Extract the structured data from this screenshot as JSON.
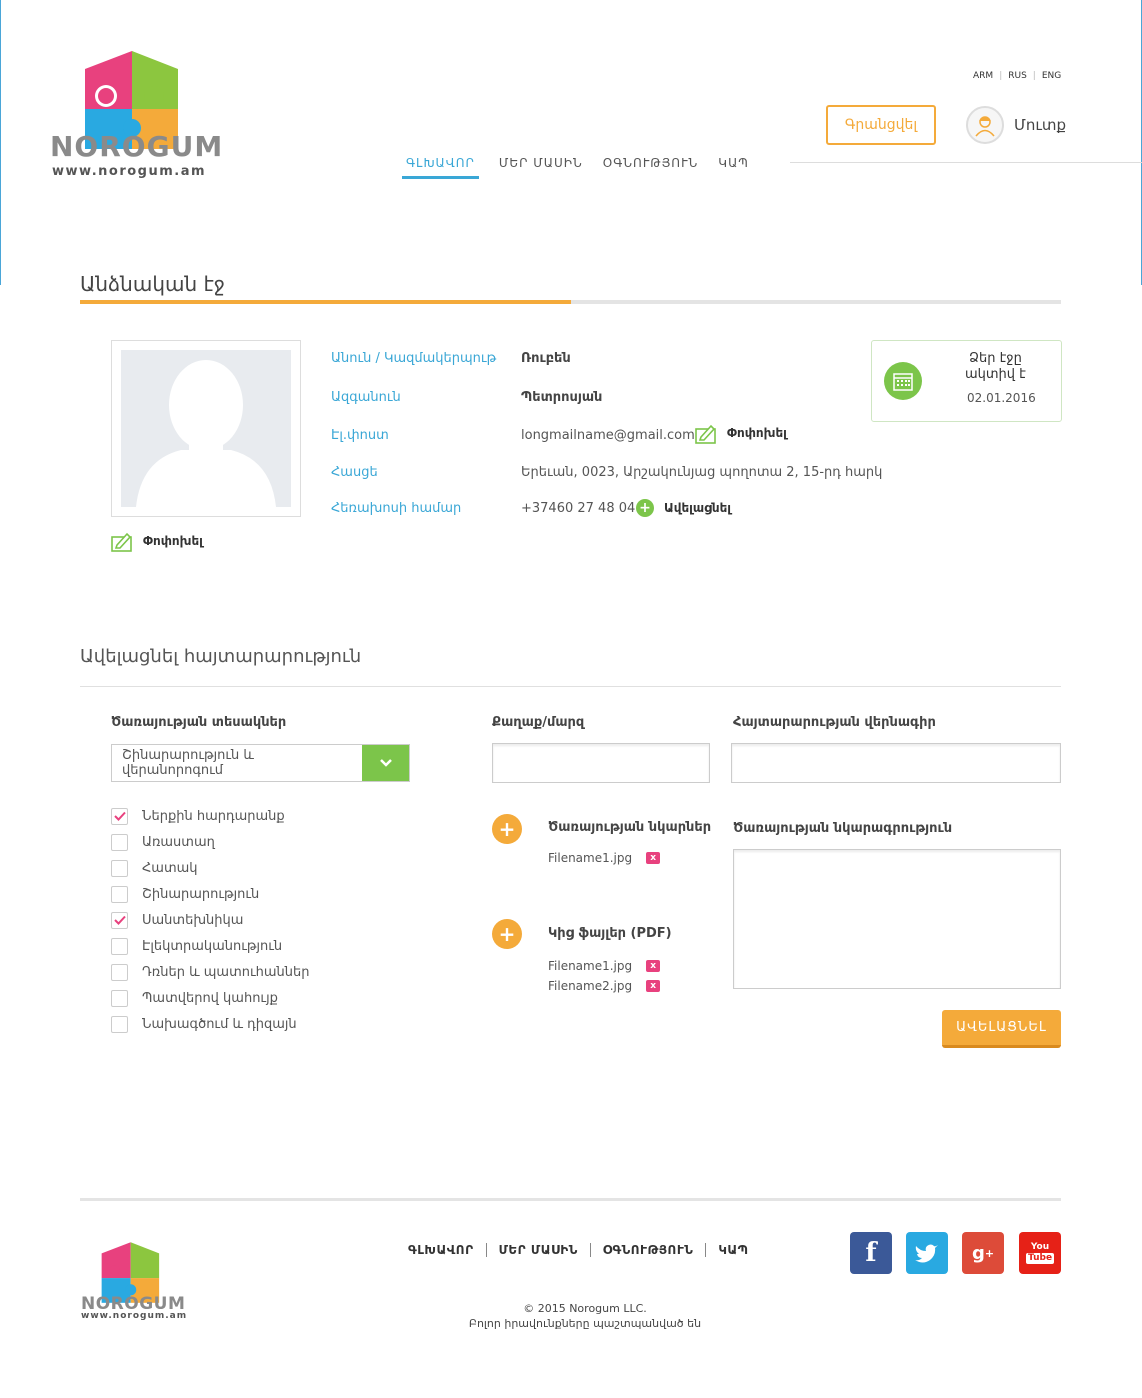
{
  "header": {
    "logo_word": "NOROGUM",
    "logo_url": "www.norogum.am",
    "languages": [
      "ARM",
      "RUS",
      "ENG"
    ],
    "register_label": "Գրանցվել",
    "login_label": "Մուտք",
    "nav": [
      "ԳԼԽԱՎՈՐ",
      "ՄԵՐ ՄԱՍԻՆ",
      "ՕԳՆՈՒԹՅՈՒՆ",
      "ԿԱՊ"
    ]
  },
  "profile": {
    "page_title": "Անձնական էջ",
    "edit_photo_label": "Փոփոխել",
    "fields": {
      "name_label": "Անուն / Կազմակերպութ",
      "name_value": "Ռուբեն",
      "surname_label": "Ազգանուն",
      "surname_value": "Պետրոսյան",
      "email_label": "Էլ.փոստ",
      "email_value": "longmailname@gmail.com",
      "email_edit_label": "Փոփոխել",
      "address_label": "Հասցե",
      "address_value": "Երեւան, 0023, Արշակունյաց պողոտա 2, 15-րդ հարկ",
      "phone_label": "Հեռախոսի համար",
      "phone_value": "+37460 27 48 04",
      "phone_add_label": "Ավելացնել"
    },
    "status": {
      "text_line1": "Ձեր էջը",
      "text_line2": "ակտիվ է",
      "date": "02.01.2016"
    }
  },
  "announcement": {
    "title": "Ավելացնել հայտարարություն",
    "service_types_label": "Ծառայության տեսակներ",
    "service_select_value": "Շինարարություն և վերանորոգում",
    "checkboxes": [
      {
        "label": "Ներքին հարդարանք",
        "checked": true
      },
      {
        "label": "Առաստաղ",
        "checked": false
      },
      {
        "label": "Հատակ",
        "checked": false
      },
      {
        "label": "Շինարարություն",
        "checked": false
      },
      {
        "label": "Սանտեխնիկա",
        "checked": true
      },
      {
        "label": "Էլեկտրականություն",
        "checked": false
      },
      {
        "label": "Դռներ և պատուհաններ",
        "checked": false
      },
      {
        "label": "Պատվերով կահույք",
        "checked": false
      },
      {
        "label": "Նախագծում և դիզայն",
        "checked": false
      }
    ],
    "city_label": "Քաղաք/մարզ",
    "city_value": "",
    "heading_label": "Հայտարարության վերնագիր",
    "heading_value": "",
    "photos_label": "Ծառայության նկարներ",
    "photos_files": [
      "Filename1.jpg"
    ],
    "attachments_label": "Կից ֆայլեր (PDF)",
    "attachments_files": [
      "Filename1.jpg",
      "Filename2.jpg"
    ],
    "description_label": "Ծառայության նկարագրություն",
    "description_value": "",
    "submit_label": "ԱՎԵԼԱՑՆԵԼ"
  },
  "footer": {
    "logo_word": "NOROGUM",
    "logo_url": "www.norogum.am",
    "nav": [
      "ԳԼԽԱՎՈՐ",
      "ՄԵՐ ՄԱՍԻՆ",
      "ՕԳՆՈՒԹՅՈՒՆ",
      "ԿԱՊ"
    ],
    "copyright_line1": "© 2015 Norogum LLC.",
    "copyright_line2": "Բոլոր իրավունքները պաշտպանված են",
    "social": [
      {
        "name": "facebook",
        "glyph": "f",
        "color": "#3b5998"
      },
      {
        "name": "twitter",
        "glyph": "t",
        "color": "#29a9e1"
      },
      {
        "name": "google-plus",
        "glyph": "g+",
        "color": "#dd4b39"
      },
      {
        "name": "youtube",
        "glyph": "You Tube",
        "color": "#e62117"
      }
    ]
  },
  "colors": {
    "accent_orange": "#f4aa3a",
    "accent_blue": "#3aa7d6",
    "accent_green": "#7cc54a",
    "remove_pink": "#e8417e"
  }
}
